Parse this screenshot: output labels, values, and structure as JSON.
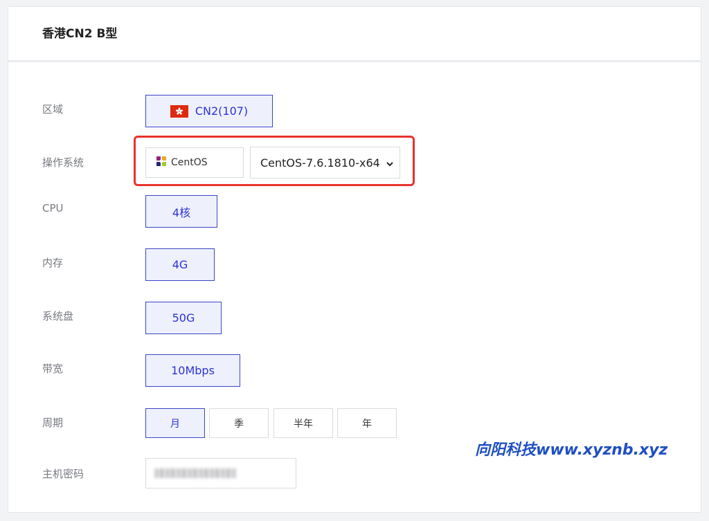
{
  "product": {
    "title": "香港CN2 B型"
  },
  "rows": {
    "region": {
      "label": "区域",
      "option": "CN2(107)"
    },
    "os": {
      "label": "操作系统",
      "os_name": "CentOS",
      "version_selected": "CentOS-7.6.1810-x64"
    },
    "cpu": {
      "label": "CPU",
      "option": "4核"
    },
    "memory": {
      "label": "内存",
      "option": "4G"
    },
    "disk": {
      "label": "系统盘",
      "option": "50G"
    },
    "bandwidth": {
      "label": "带宽",
      "option": "10Mbps"
    },
    "period": {
      "label": "周期",
      "options": [
        "月",
        "季",
        "半年",
        "年"
      ],
      "selected_index": 0
    },
    "password": {
      "label": "主机密码"
    }
  },
  "watermark": "向阳科技www.xyznb.xyz",
  "colors": {
    "accent": "#2c33d6",
    "accent_border": "#3a45c8",
    "selected_bg": "#eef0fc",
    "highlight_box": "#e8322c",
    "flag_red": "#de2910",
    "watermark": "#1e4fc2"
  },
  "icons": {
    "region_flag": "hong-kong-flag-icon",
    "os_logo": "centos-logo-icon",
    "select_arrow": "chevron-down-icon"
  }
}
